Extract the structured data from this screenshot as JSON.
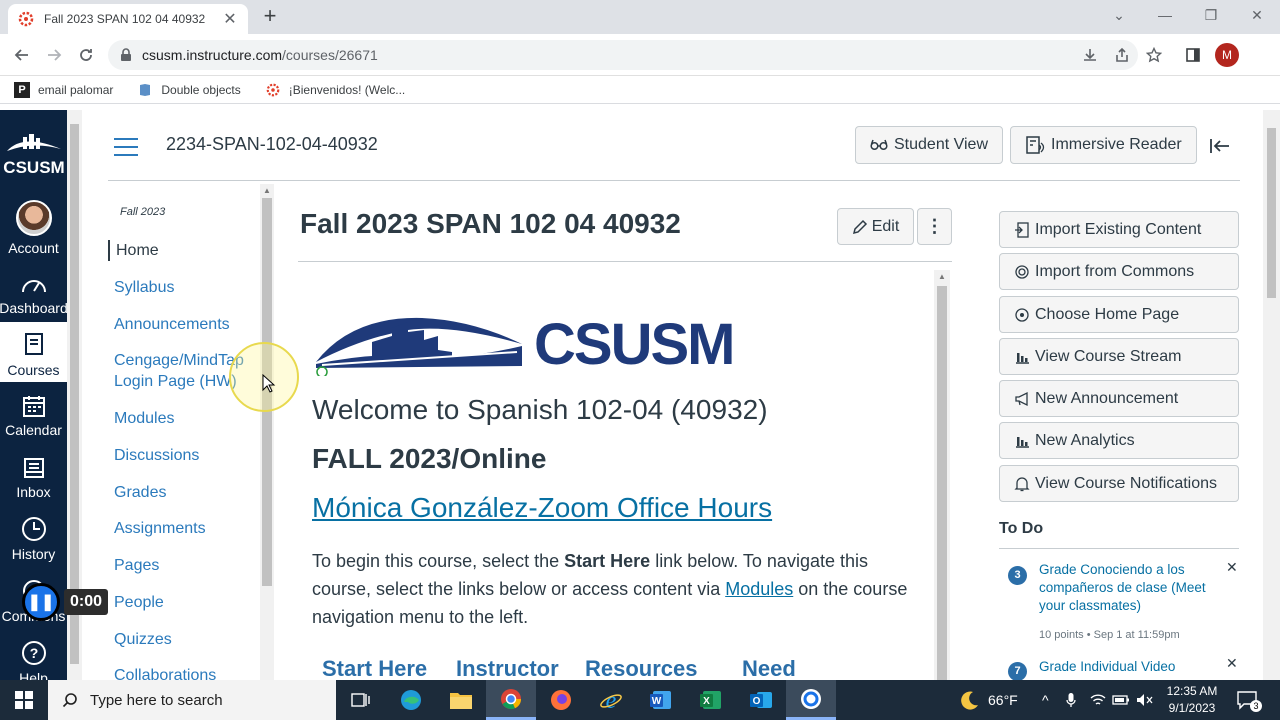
{
  "browser": {
    "tab_title": "Fall 2023 SPAN 102 04 40932",
    "url_domain": "csusm.instructure.com",
    "url_path": "/courses/26671",
    "profile_initial": "M",
    "bookmarks": [
      {
        "label": "email palomar",
        "icon": "palomar-icon"
      },
      {
        "label": "Double objects",
        "icon": "document-icon"
      },
      {
        "label": "¡Bienvenidos! (Welc...",
        "icon": "canvas-icon"
      }
    ]
  },
  "global_nav": {
    "logo_text": "CSUSM",
    "items": [
      {
        "label": "Account",
        "icon": "avatar"
      },
      {
        "label": "Dashboard",
        "icon": "dashboard-icon"
      },
      {
        "label": "Courses",
        "icon": "courses-icon",
        "active": true
      },
      {
        "label": "Calendar",
        "icon": "calendar-icon"
      },
      {
        "label": "Inbox",
        "icon": "inbox-icon"
      },
      {
        "label": "History",
        "icon": "history-icon"
      },
      {
        "label": "Commons",
        "icon": "commons-icon"
      },
      {
        "label": "Help",
        "icon": "help-icon"
      }
    ]
  },
  "header": {
    "course_code": "2234-SPAN-102-04-40932",
    "student_view": "Student View",
    "immersive_reader": "Immersive Reader"
  },
  "course_nav": {
    "term": "Fall 2023",
    "items": [
      "Home",
      "Syllabus",
      "Announcements",
      "Cengage/MindTap Login Page (HW)",
      "Modules",
      "Discussions",
      "Grades",
      "Assignments",
      "Pages",
      "People",
      "Quizzes",
      "Collaborations"
    ]
  },
  "main": {
    "title": "Fall 2023 SPAN 102 04 40932",
    "edit_label": "Edit",
    "more_label": "⋮",
    "logo_text": "CSUSM",
    "welcome": "Welcome to Spanish 102-04 (40932)",
    "session": "FALL 2023/Online",
    "zoom_link": "Mónica González-Zoom Office Hours",
    "intro_part1": "To begin this course, select the ",
    "intro_bold": "Start Here",
    "intro_part2": " link below. To navigate this course, select the links below or access content via ",
    "intro_link": "Modules",
    "intro_part3": " on the course navigation menu to the left.",
    "tab_links": [
      "Start Here",
      "Instructor",
      "Resources",
      "Need"
    ]
  },
  "sidebar": {
    "buttons": [
      {
        "label": "Import Existing Content",
        "icon": "import-icon"
      },
      {
        "label": "Import from Commons",
        "icon": "commons-icon"
      },
      {
        "label": "Choose Home Page",
        "icon": "target-icon"
      },
      {
        "label": "View Course Stream",
        "icon": "bar-chart-icon"
      },
      {
        "label": "New Announcement",
        "icon": "megaphone-icon"
      },
      {
        "label": "New Analytics",
        "icon": "bar-chart-icon"
      },
      {
        "label": "View Course Notifications",
        "icon": "bell-icon"
      }
    ],
    "todo_title": "To Do",
    "todos": [
      {
        "badge": "3",
        "title": "Grade Conociendo a los compañeros de clase (Meet your classmates)",
        "meta": "10 points • Sep 1 at 11:59pm"
      },
      {
        "badge": "7",
        "title": "Grade Individual Video",
        "meta": ""
      }
    ]
  },
  "recorder": {
    "time": "0:00"
  },
  "taskbar": {
    "search_placeholder": "Type here to search",
    "weather": "66°F",
    "time": "12:35 AM",
    "date": "9/1/2023",
    "notification_count": "3"
  }
}
